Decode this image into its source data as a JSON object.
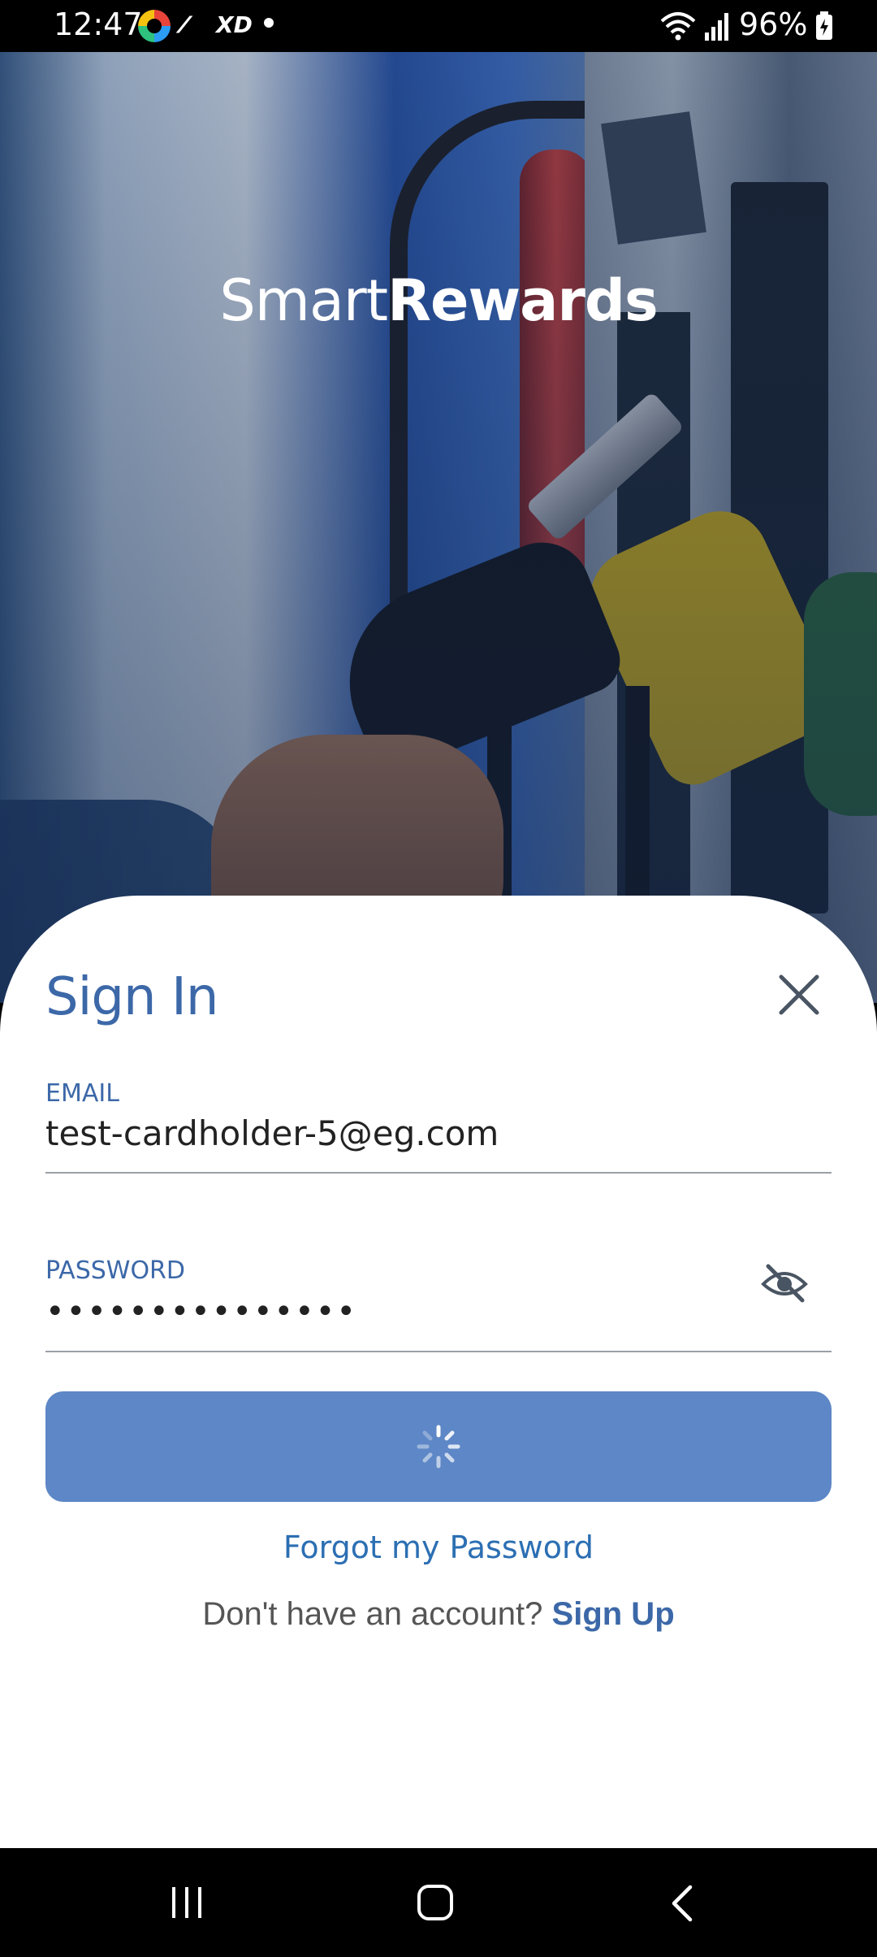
{
  "status_bar": {
    "time": "12:47",
    "xd_label": "XD",
    "battery": "96%",
    "icons": [
      "app-icon",
      "missed-call-icon",
      "wifi-icon",
      "signal-icon",
      "battery-charging-icon"
    ]
  },
  "app": {
    "logo_light": "Smart",
    "logo_bold": "Rewards"
  },
  "signin": {
    "title": "Sign In",
    "email_label": "EMAIL",
    "email_value": "test-cardholder-5@eg.com",
    "password_label": "PASSWORD",
    "password_value": "•••••••••••••••",
    "forgot_label": "Forgot my Password",
    "no_account_text": "Don't have an account?",
    "signup_label": "Sign Up",
    "loading": true
  },
  "colors": {
    "accent": "#3c68a8",
    "button": "#5d87c6",
    "link": "#2c6fb3"
  }
}
